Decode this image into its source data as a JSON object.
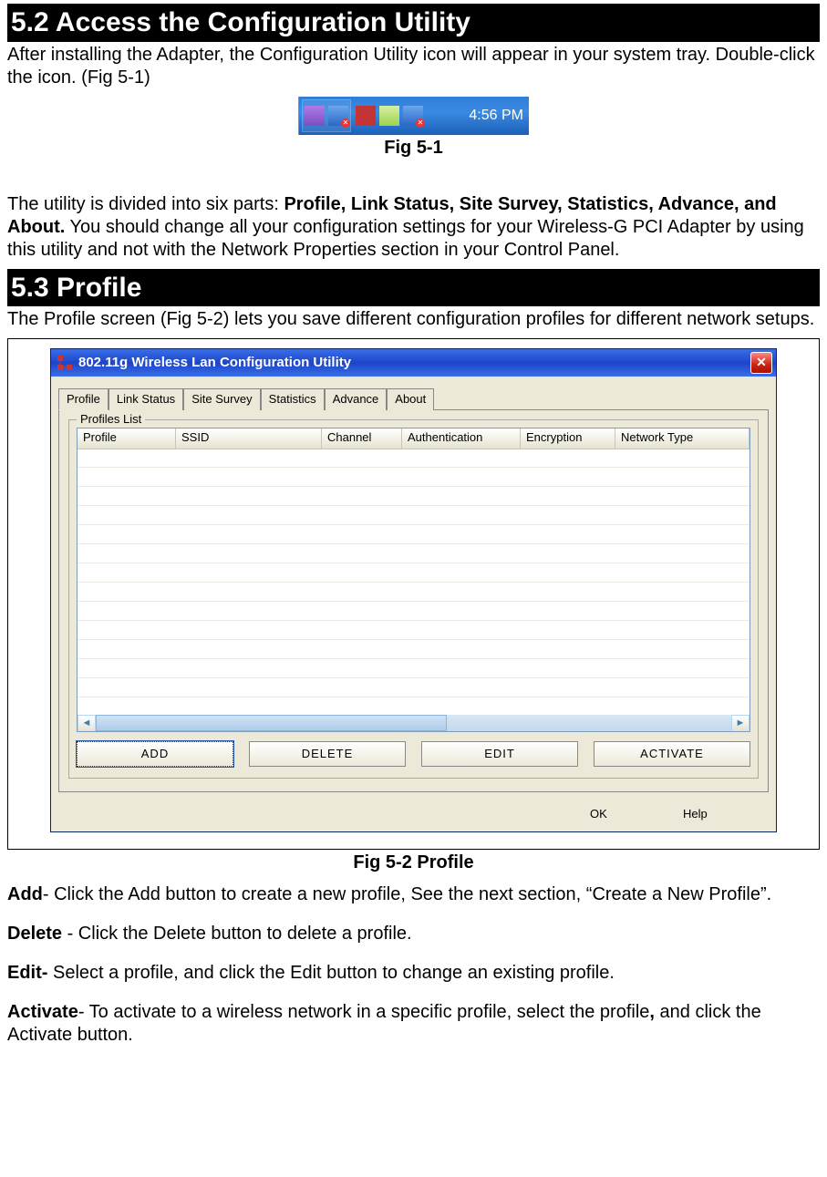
{
  "section52": {
    "title": "5.2 Access the Configuration Utility",
    "intro": "After installing the Adapter, the Configuration Utility icon will appear in your system tray. Double-click the icon. (Fig 5-1)",
    "clock": "4:56 PM"
  },
  "caption_fig51": "Fig 5-1",
  "para_utility_parts_pre": "The utility is divided into six parts: ",
  "para_utility_parts_bold": "Profile, Link Status, Site Survey, Statistics, Advance, and About.",
  "para_utility_parts_post": " You should change all your configuration settings for your Wireless-G PCI Adapter by using this utility and not with the Network Properties section in your Control Panel.",
  "section53": {
    "title": "5.3 Profile",
    "intro": "The Profile screen (Fig 5-2) lets you save different configuration profiles for different network setups."
  },
  "dialog": {
    "title": "802.11g Wireless Lan Configuration Utility",
    "tabs": [
      "Profile",
      "Link Status",
      "Site Survey",
      "Statistics",
      "Advance",
      "About"
    ],
    "group_label": "Profiles List",
    "columns": [
      "Profile",
      "SSID",
      "Channel",
      "Authentication",
      "Encryption",
      "Network Type"
    ],
    "buttons": [
      "ADD",
      "DELETE",
      "EDIT",
      "ACTIVATE"
    ],
    "dlg_buttons": [
      "OK",
      "Help"
    ]
  },
  "caption_fig52": "Fig 5-2 Profile",
  "defs": {
    "add_label": "Add",
    "add_text": "- Click the Add button to create a new profile, See the next section, “Create a New Profile”.",
    "delete_label": "Delete",
    "delete_text": " - Click the Delete button to delete a profile.",
    "edit_label": "Edit-",
    "edit_text": " Select a profile, and click the Edit button to change an existing profile.",
    "activate_label": "Activate",
    "activate_mid": "- To activate to a wireless network in a specific profile, select the profile",
    "activate_comma": ",",
    "activate_post": " and click the Activate button."
  }
}
